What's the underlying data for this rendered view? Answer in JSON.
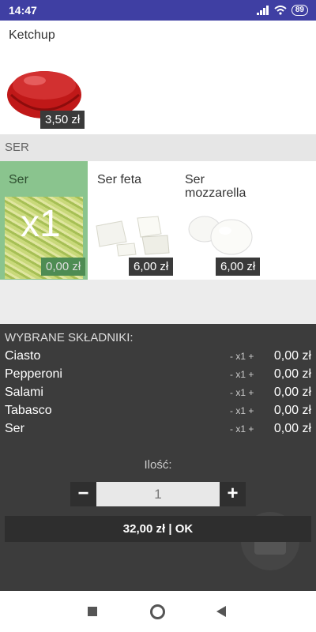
{
  "status": {
    "time": "14:47",
    "battery": "89"
  },
  "top_item": {
    "name": "Ketchup",
    "price": "3,50 zł"
  },
  "section": {
    "label": "SER"
  },
  "products": [
    {
      "name": "Ser",
      "price": "0,00 zł",
      "badge": "x1",
      "selected": true
    },
    {
      "name": "Ser feta",
      "price": "6,00 zł"
    },
    {
      "name": "Ser mozzarella",
      "price": "6,00 zł"
    }
  ],
  "selected": {
    "title": "WYBRANE SKŁADNIKI:",
    "items": [
      {
        "name": "Ciasto",
        "qty": "- x1 +",
        "price": "0,00 zł"
      },
      {
        "name": "Pepperoni",
        "qty": "- x1 +",
        "price": "0,00 zł"
      },
      {
        "name": "Salami",
        "qty": "- x1 +",
        "price": "0,00 zł"
      },
      {
        "name": "Tabasco",
        "qty": "- x1 +",
        "price": "0,00 zł"
      },
      {
        "name": "Ser",
        "qty": "- x1 +",
        "price": "0,00 zł"
      }
    ]
  },
  "quantity": {
    "label": "Ilość:",
    "value": "1",
    "minus": "−",
    "plus": "+"
  },
  "confirm": {
    "label": "32,00 zł | OK"
  },
  "colors": {
    "statusbar": "#3f3fa3",
    "selected_tile": "#8ac48e",
    "panel": "#3c3c3c"
  }
}
